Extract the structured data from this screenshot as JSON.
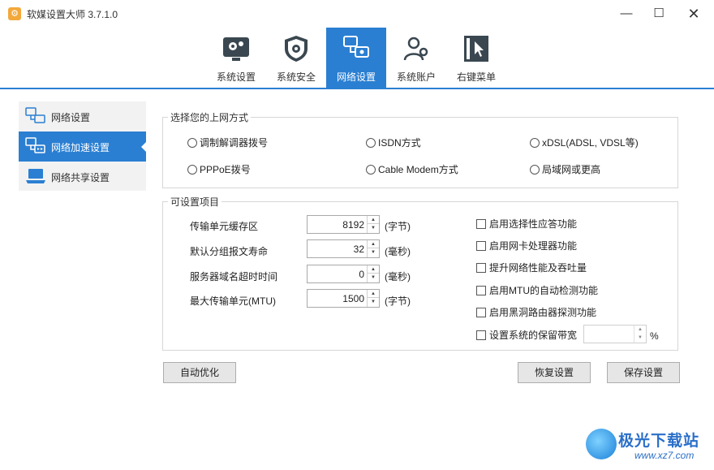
{
  "window": {
    "title": "软媒设置大师 3.7.1.0",
    "minimize": "—",
    "maximize": "☐",
    "close": "✕"
  },
  "toolbar": {
    "items": [
      {
        "label": "系统设置",
        "icon": "gear-monitor-icon"
      },
      {
        "label": "系统安全",
        "icon": "shield-icon"
      },
      {
        "label": "网络设置",
        "icon": "network-icon",
        "active": true
      },
      {
        "label": "系统账户",
        "icon": "users-icon"
      },
      {
        "label": "右键菜单",
        "icon": "cursor-menu-icon"
      }
    ]
  },
  "sidebar": {
    "items": [
      {
        "label": "网络设置",
        "icon": "network-settings-icon"
      },
      {
        "label": "网络加速设置",
        "icon": "network-speed-icon",
        "active": true
      },
      {
        "label": "网络共享设置",
        "icon": "laptop-share-icon"
      }
    ]
  },
  "connection": {
    "title": "选择您的上网方式",
    "options": [
      "调制解调器拨号",
      "ISDN方式",
      "xDSL(ADSL, VDSL等)",
      "PPPoE拨号",
      "Cable Modem方式",
      "局域网或更高"
    ]
  },
  "settings": {
    "title": "可设置项目",
    "fields": [
      {
        "label": "传输单元缓存区",
        "value": "8192",
        "unit": "(字节)"
      },
      {
        "label": "默认分组报文寿命",
        "value": "32",
        "unit": "(毫秒)"
      },
      {
        "label": "服务器域名超时时间",
        "value": "0",
        "unit": "(毫秒)"
      },
      {
        "label": "最大传输单元(MTU)",
        "value": "1500",
        "unit": "(字节)"
      }
    ],
    "checkboxes": [
      "启用选择性应答功能",
      "启用网卡处理器功能",
      "提升网络性能及吞吐量",
      "启用MTU的自动检测功能",
      "启用黑洞路由器探测功能",
      "设置系统的保留带宽"
    ],
    "percent_sign": "%"
  },
  "buttons": {
    "auto_optimize": "自动优化",
    "restore": "恢复设置",
    "save": "保存设置"
  },
  "watermark": {
    "text": "极光下载站",
    "url": "www.xz7.com"
  },
  "colors": {
    "accent": "#2b7fd2"
  }
}
